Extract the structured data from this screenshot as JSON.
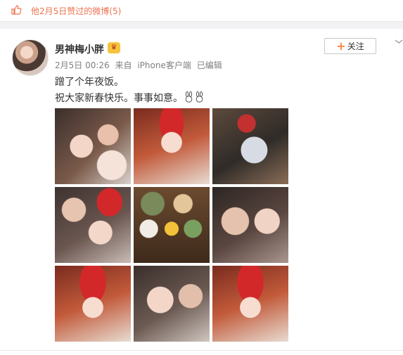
{
  "likes_header": {
    "text": "他2月5日赞过的微博(5)",
    "icon": "thumbs-up-icon",
    "color": "#eb7350"
  },
  "post": {
    "username": "男神梅小胖",
    "badge": "VIP",
    "follow_label": "关注",
    "follow_icon": "plus-icon",
    "meta": {
      "date_time": "2月5日 00:26",
      "source_prefix": "来自",
      "source": "iPhone客户端",
      "edited": "已编辑"
    },
    "lines": [
      "蹭了个年夜饭。",
      "祝大家新春快乐。事事如意。"
    ],
    "emoji": [
      "rabbit-emoji-icon",
      "rabbit-emoji-icon"
    ],
    "photos": [
      {
        "name": "photo-1"
      },
      {
        "name": "photo-2"
      },
      {
        "name": "photo-3"
      },
      {
        "name": "photo-4"
      },
      {
        "name": "photo-5"
      },
      {
        "name": "photo-6"
      },
      {
        "name": "photo-7"
      },
      {
        "name": "photo-8"
      },
      {
        "name": "photo-9"
      }
    ]
  }
}
